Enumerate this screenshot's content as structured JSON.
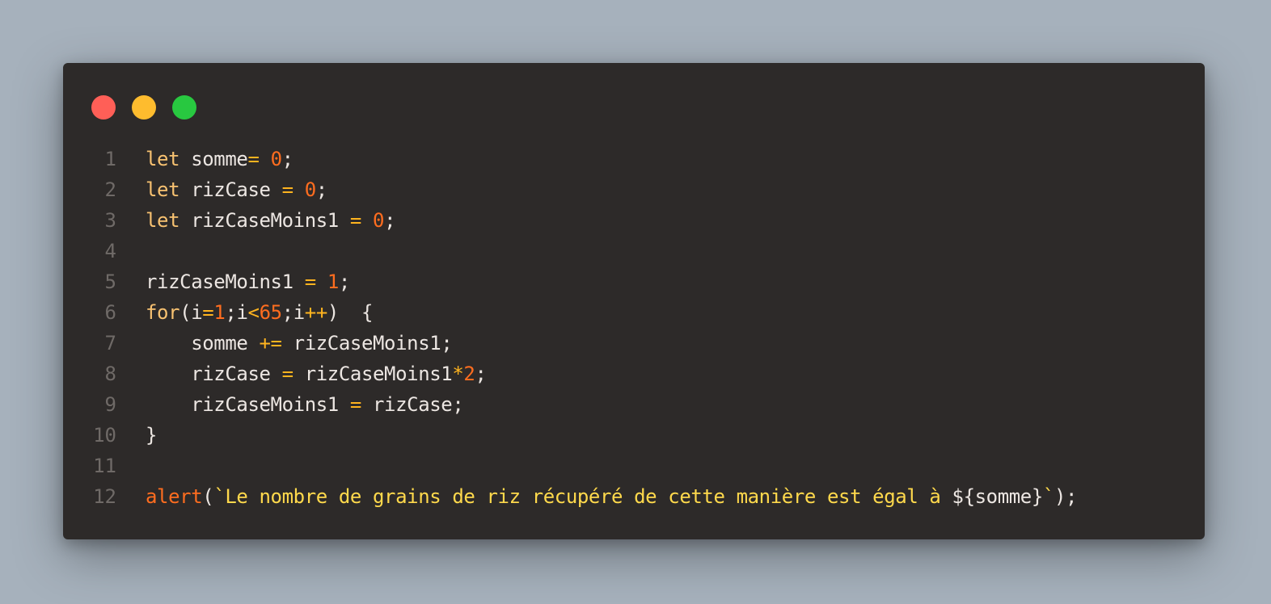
{
  "window": {
    "traffic_lights": [
      {
        "name": "close",
        "color": "#ff5f57"
      },
      {
        "name": "minimize",
        "color": "#febc2e"
      },
      {
        "name": "maximize",
        "color": "#28c840"
      }
    ]
  },
  "theme": {
    "background": "#2d2a29",
    "keyword": "#f8c271",
    "operator": "#ffb41f",
    "number": "#ff6d1f",
    "function": "#ff6d1f",
    "string": "#ffd94c",
    "identifier": "#ece6e2",
    "line_number": "#6f6a67"
  },
  "code": {
    "lines": [
      {
        "number": "1",
        "tokens": [
          {
            "t": "keyword",
            "v": "let"
          },
          {
            "t": "ident",
            "v": " somme"
          },
          {
            "t": "operator",
            "v": "="
          },
          {
            "t": "ident",
            "v": " "
          },
          {
            "t": "number",
            "v": "0"
          },
          {
            "t": "punct",
            "v": ";"
          }
        ]
      },
      {
        "number": "2",
        "tokens": [
          {
            "t": "keyword",
            "v": "let"
          },
          {
            "t": "ident",
            "v": " rizCase "
          },
          {
            "t": "operator",
            "v": "="
          },
          {
            "t": "ident",
            "v": " "
          },
          {
            "t": "number",
            "v": "0"
          },
          {
            "t": "punct",
            "v": ";"
          }
        ]
      },
      {
        "number": "3",
        "tokens": [
          {
            "t": "keyword",
            "v": "let"
          },
          {
            "t": "ident",
            "v": " rizCaseMoins1 "
          },
          {
            "t": "operator",
            "v": "="
          },
          {
            "t": "ident",
            "v": " "
          },
          {
            "t": "number",
            "v": "0"
          },
          {
            "t": "punct",
            "v": ";"
          }
        ]
      },
      {
        "number": "4",
        "tokens": []
      },
      {
        "number": "5",
        "tokens": [
          {
            "t": "ident",
            "v": "rizCaseMoins1 "
          },
          {
            "t": "operator",
            "v": "="
          },
          {
            "t": "ident",
            "v": " "
          },
          {
            "t": "number",
            "v": "1"
          },
          {
            "t": "punct",
            "v": ";"
          }
        ]
      },
      {
        "number": "6",
        "tokens": [
          {
            "t": "keyword",
            "v": "for"
          },
          {
            "t": "punct",
            "v": "(i"
          },
          {
            "t": "operator",
            "v": "="
          },
          {
            "t": "number",
            "v": "1"
          },
          {
            "t": "punct",
            "v": ";i"
          },
          {
            "t": "operator",
            "v": "<"
          },
          {
            "t": "number",
            "v": "65"
          },
          {
            "t": "punct",
            "v": ";i"
          },
          {
            "t": "operator",
            "v": "++"
          },
          {
            "t": "punct",
            "v": ")  {"
          }
        ]
      },
      {
        "number": "7",
        "tokens": [
          {
            "t": "ident",
            "v": "    somme "
          },
          {
            "t": "operator",
            "v": "+="
          },
          {
            "t": "ident",
            "v": " rizCaseMoins1"
          },
          {
            "t": "punct",
            "v": ";"
          }
        ]
      },
      {
        "number": "8",
        "tokens": [
          {
            "t": "ident",
            "v": "    rizCase "
          },
          {
            "t": "operator",
            "v": "="
          },
          {
            "t": "ident",
            "v": " rizCaseMoins1"
          },
          {
            "t": "operator",
            "v": "*"
          },
          {
            "t": "number",
            "v": "2"
          },
          {
            "t": "punct",
            "v": ";"
          }
        ]
      },
      {
        "number": "9",
        "tokens": [
          {
            "t": "ident",
            "v": "    rizCaseMoins1 "
          },
          {
            "t": "operator",
            "v": "="
          },
          {
            "t": "ident",
            "v": " rizCase"
          },
          {
            "t": "punct",
            "v": ";"
          }
        ]
      },
      {
        "number": "10",
        "tokens": [
          {
            "t": "punct",
            "v": "}"
          }
        ]
      },
      {
        "number": "11",
        "tokens": []
      },
      {
        "number": "12",
        "tokens": [
          {
            "t": "func",
            "v": "alert"
          },
          {
            "t": "punct",
            "v": "("
          },
          {
            "t": "string",
            "v": "`Le nombre de grains de riz récupéré de cette manière est égal à "
          },
          {
            "t": "ident",
            "v": "${somme}"
          },
          {
            "t": "string",
            "v": "`"
          },
          {
            "t": "punct",
            "v": ");"
          }
        ]
      }
    ]
  }
}
